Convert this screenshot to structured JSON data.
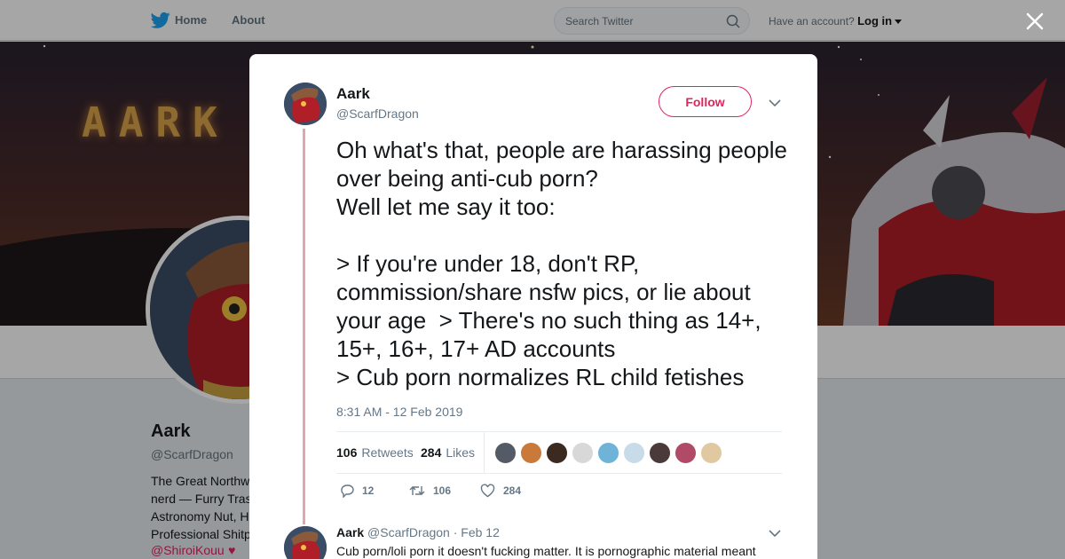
{
  "nav": {
    "home_label": "Home",
    "about_label": "About",
    "search_placeholder": "Search Twitter",
    "account_prompt": "Have an account?",
    "login_label": "Log in"
  },
  "banner": {
    "title": "AARK"
  },
  "profile": {
    "name": "Aark",
    "handle": "@ScarfDragon",
    "bio": "The Great Northw\nnerd — Furry Tras\nAstronomy Nut, H\nProfessional Shitp",
    "bio_link": "@ShiroiKouu",
    "bio_heart": "♥"
  },
  "tweet": {
    "name": "Aark",
    "handle": "@ScarfDragon",
    "follow_label": "Follow",
    "text": "Oh what's that, people are harassing people over being anti-cub porn?\nWell let me say it too:\n\n> If you're under 18, don't RP, commission/share nsfw pics, or lie about your age  > There's no such thing as 14+, 15+, 16+, 17+ AD accounts\n> Cub porn normalizes RL child fetishes",
    "timestamp": "8:31 AM - 12 Feb 2019",
    "retweets_count": "106",
    "retweets_label": "Retweets",
    "likes_count": "284",
    "likes_label": "Likes",
    "likers": [
      "#555b66",
      "#c97a3a",
      "#3a2a20",
      "#d8d8d8",
      "#6fb3d9",
      "#c8dbe8",
      "#4a3a3a",
      "#b04a66",
      "#e0c9a0"
    ],
    "reply_count": "12",
    "retweet_action_count": "106",
    "like_action_count": "284"
  },
  "reply": {
    "name": "Aark",
    "handle": "@ScarfDragon",
    "date": "· Feb 12",
    "text": "Cub porn/loli porn it doesn't fucking matter. It is pornographic material meant"
  },
  "colors": {
    "accent": "#e0245e",
    "thread_line": "#e0a6ae",
    "twitter_blue": "#1da1f2"
  }
}
